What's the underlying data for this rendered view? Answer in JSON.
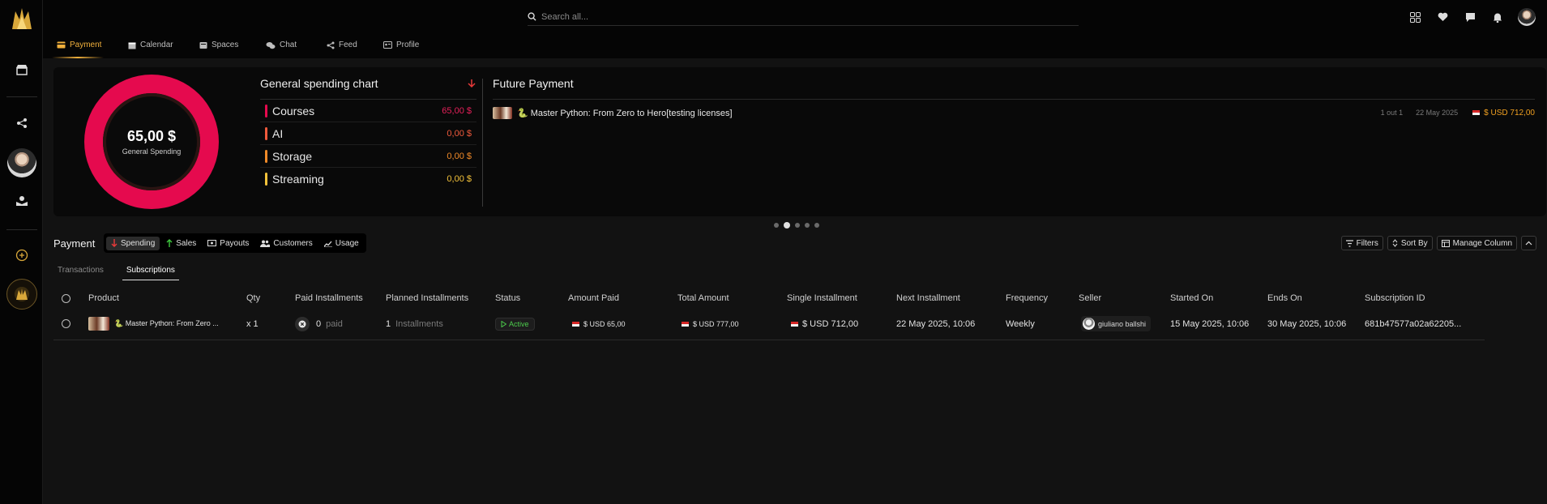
{
  "search": {
    "placeholder": "Search all..."
  },
  "nav": {
    "tabs": [
      {
        "label": "Payment",
        "icon": "card-icon"
      },
      {
        "label": "Calendar",
        "icon": "calendar-icon"
      },
      {
        "label": "Spaces",
        "icon": "spaces-icon"
      },
      {
        "label": "Chat",
        "icon": "chat-icon"
      },
      {
        "label": "Feed",
        "icon": "share-icon"
      },
      {
        "label": "Profile",
        "icon": "profile-card-icon"
      }
    ]
  },
  "spending": {
    "total": "65,00 $",
    "total_label": "General Spending",
    "title": "General spending chart",
    "items": [
      {
        "name": "Courses",
        "value": "65,00 $",
        "color": "#e50a4e"
      },
      {
        "name": "AI",
        "value": "0,00 $",
        "color": "#f05a3c"
      },
      {
        "name": "Storage",
        "value": "0,00 $",
        "color": "#f08a28"
      },
      {
        "name": "Streaming",
        "value": "0,00 $",
        "color": "#f3c23a"
      }
    ]
  },
  "future": {
    "title": "Future Payment",
    "item": {
      "name": "🐍 Master Python: From Zero to Hero[testing licenses]",
      "count": "1 out 1",
      "date": "22 May 2025",
      "amount": "$ USD 712,00"
    }
  },
  "payment": {
    "title": "Payment",
    "tabs": [
      "Spending",
      "Sales",
      "Payouts",
      "Customers",
      "Usage"
    ],
    "actions": [
      "Filters",
      "Sort By",
      "Manage Column"
    ],
    "subtabs": [
      "Transactions",
      "Subscriptions"
    ]
  },
  "table": {
    "headers": [
      "Product",
      "Qty",
      "Paid Installments",
      "Planned Installments",
      "Status",
      "Amount Paid",
      "Total Amount",
      "Single Installment",
      "Next Installment",
      "Frequency",
      "Seller",
      "Started On",
      "Ends On",
      "Subscription ID"
    ],
    "rows": [
      {
        "product": "🐍 Master Python: From Zero ...",
        "qty": "x 1",
        "paid_count": "0",
        "paid_label": "paid",
        "planned_count": "1",
        "planned_label": "Installments",
        "status": "Active",
        "amount_paid": "$ USD 65,00",
        "total_amount": "$ USD 777,00",
        "single_installment": "$ USD 712,00",
        "next_installment": "22 May 2025, 10:06",
        "frequency": "Weekly",
        "seller": "giuliano ballshi",
        "started_on": "15 May 2025, 10:06",
        "ends_on": "30 May 2025, 10:06",
        "subscription_id": "681b47577a02a62205..."
      }
    ]
  },
  "colors": {
    "accent": "#f0b03c",
    "donut": "#e50a4e",
    "active_status": "#4ccb4c",
    "amount_orange": "#f0a020"
  }
}
